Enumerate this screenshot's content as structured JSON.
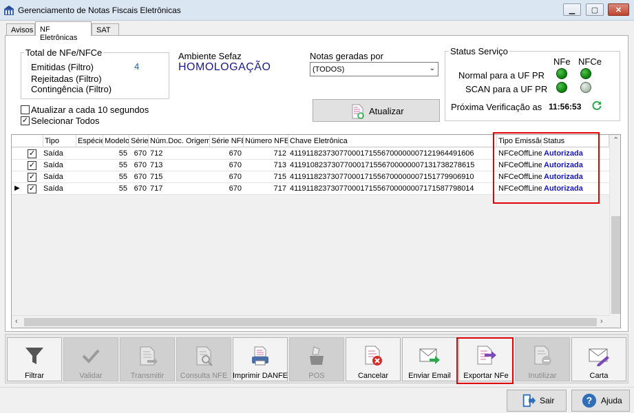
{
  "window": {
    "title": "Gerenciamento de Notas Fiscais Eletrônicas"
  },
  "tabs": [
    {
      "label": "Avisos"
    },
    {
      "label": "NF Eletrônicas"
    },
    {
      "label": "SAT"
    }
  ],
  "totals": {
    "title": "Total de NFe/NFCe",
    "emitidas_label": "Emitidas (Filtro)",
    "emitidas_value": "4",
    "rejeitadas_label": "Rejeitadas (Filtro)",
    "contingencia_label": "Contingência (Filtro)"
  },
  "ambiente": {
    "label": "Ambiente Sefaz",
    "value": "HOMOLOGAÇÃO"
  },
  "notas": {
    "label": "Notas geradas por",
    "selected": "(TODOS)"
  },
  "atualizar_button": "Atualizar",
  "options": {
    "auto_refresh": "Atualizar a cada 10 segundos",
    "auto_refresh_checked": false,
    "select_all": "Selecionar Todos",
    "select_all_checked": true
  },
  "status_servico": {
    "title": "Status Serviço",
    "col_nfe": "NFe",
    "col_nfce": "NFCe",
    "row1": "Normal para a UF PR",
    "row2": "SCAN para a UF PR",
    "next_label": "Próxima Verificação as",
    "next_time": "11:56:53",
    "colors": {
      "on": "#1a9a1a",
      "off": "#b3c2b3",
      "refresh_icon": "#2aa84a"
    }
  },
  "grid": {
    "columns": [
      "Tipo",
      "Espécie",
      "Modelo",
      "Série",
      "Núm.Doc. Origem",
      "Série NFE",
      "Número NFE",
      "Chave Eletrônica",
      "Tipo Emissão",
      "Status"
    ],
    "rows": [
      {
        "checked": true,
        "tipo": "Saída",
        "especie": "",
        "modelo": "55",
        "serie": "670",
        "num_doc_origem": "712",
        "serie_nfe": "670",
        "numero_nfe": "712",
        "chave": "41191182373077000171556700000007121964491606",
        "tipo_emissao": "NFCeOffLine",
        "status": "Autorizada"
      },
      {
        "checked": true,
        "tipo": "Saída",
        "especie": "",
        "modelo": "55",
        "serie": "670",
        "num_doc_origem": "713",
        "serie_nfe": "670",
        "numero_nfe": "713",
        "chave": "41191082373077000171556700000007131738278615",
        "tipo_emissao": "NFCeOffLine",
        "status": "Autorizada"
      },
      {
        "checked": true,
        "tipo": "Saída",
        "especie": "",
        "modelo": "55",
        "serie": "670",
        "num_doc_origem": "715",
        "serie_nfe": "670",
        "numero_nfe": "715",
        "chave": "41191182373077000171556700000007151779906910",
        "tipo_emissao": "NFCeOffLine",
        "status": "Autorizada"
      },
      {
        "checked": true,
        "tipo": "Saída",
        "especie": "",
        "modelo": "55",
        "serie": "670",
        "num_doc_origem": "717",
        "serie_nfe": "670",
        "numero_nfe": "717",
        "chave": "41191182373077000171556700000007171587798014",
        "tipo_emissao": "NFCeOffLine",
        "status": "Autorizada"
      }
    ],
    "current_row_marker": "▶"
  },
  "toolbar": {
    "buttons": [
      {
        "label": "Filtrar",
        "icon": "filter-icon",
        "enabled": true
      },
      {
        "label": "Validar",
        "icon": "check-icon",
        "enabled": false
      },
      {
        "label": "Transmitir",
        "icon": "transmit-icon",
        "enabled": false
      },
      {
        "label": "Consulta NFE",
        "icon": "document-search-icon",
        "enabled": false
      },
      {
        "label": "Imprimir DANFE",
        "icon": "printer-icon",
        "enabled": true
      },
      {
        "label": "POS",
        "icon": "pos-printer-icon",
        "enabled": false
      },
      {
        "label": "Cancelar",
        "icon": "document-cancel-icon",
        "enabled": true
      },
      {
        "label": "Enviar Email",
        "icon": "email-icon",
        "enabled": true
      },
      {
        "label": "Exportar NFe",
        "icon": "document-export-icon",
        "enabled": true
      },
      {
        "label": "Inutilizar",
        "icon": "document-void-icon",
        "enabled": false
      },
      {
        "label": "Carta",
        "icon": "letter-pencil-icon",
        "enabled": true
      }
    ]
  },
  "bottom": {
    "sair": "Sair",
    "ajuda": "Ajuda"
  },
  "colors": {
    "highlight": "#e00000",
    "status_text": "#1515c8",
    "ambiente_text": "#1a1a8c"
  }
}
